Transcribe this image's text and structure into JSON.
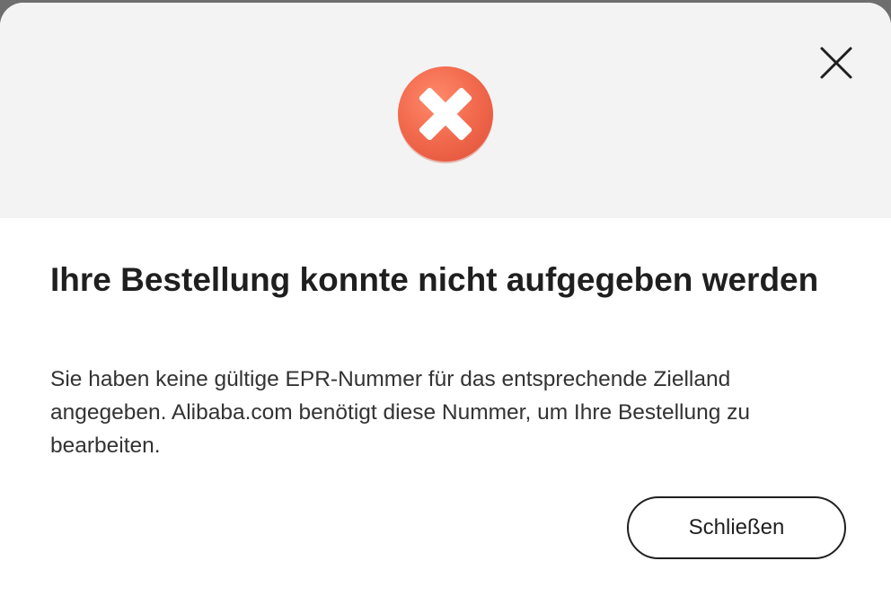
{
  "dialog": {
    "title": "Ihre Bestellung konnte nicht aufgegeben werden",
    "message": "Sie haben keine gültige EPR-Nummer für das entsprechende Zielland angegeben. Alibaba.com benötigt diese Nummer, um Ihre Bestellung zu bearbeiten.",
    "close_button_label": "Schließen",
    "status_icon": "error-x-icon",
    "dismiss_icon": "close-icon"
  },
  "colors": {
    "header_background": "#f3f3f3",
    "error_red": "#f36b4f",
    "text_primary": "#1f1f1f",
    "text_secondary": "#333333"
  }
}
